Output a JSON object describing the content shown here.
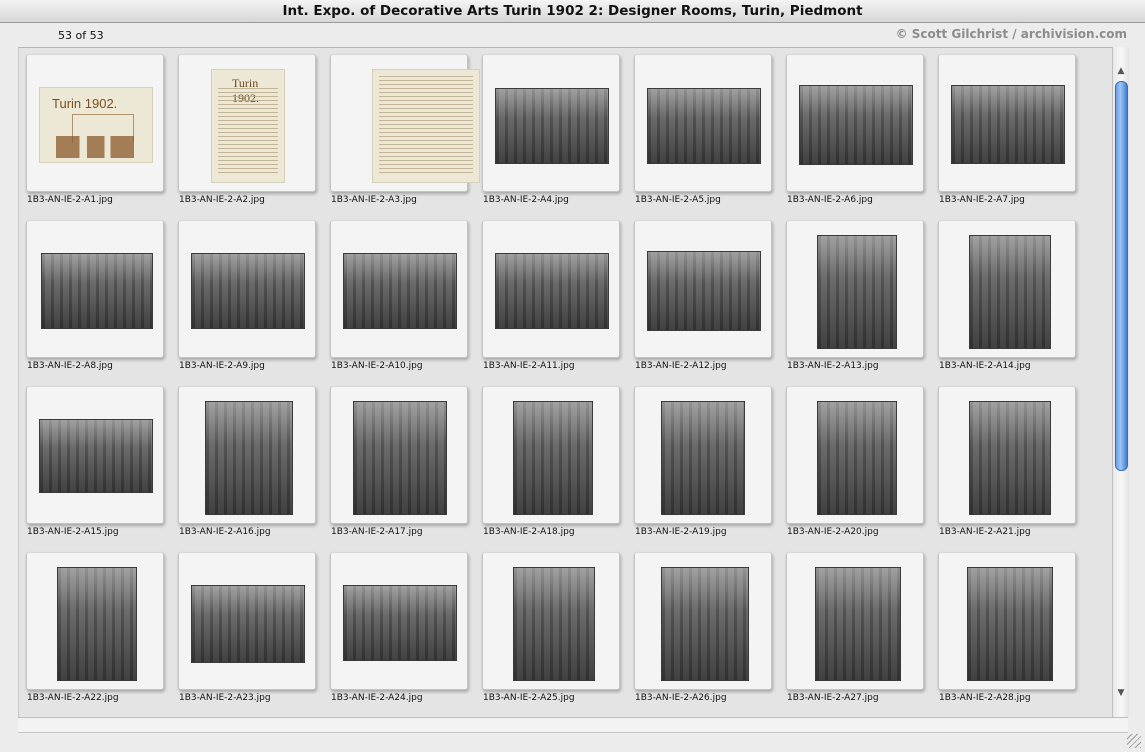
{
  "window": {
    "title": "Int. Expo. of Decorative Arts Turin 1902 2: Designer Rooms, Turin, Piedmont"
  },
  "header": {
    "count": "53 of 53",
    "credit": "© Scott Gilchrist / archivision.com"
  },
  "gallery": {
    "items": [
      {
        "filename": "1B3-AN-IE-2-A1.jpg",
        "image_text": "Turin 1902."
      },
      {
        "filename": "1B3-AN-IE-2-A2.jpg",
        "image_text": "Turin 1902."
      },
      {
        "filename": "1B3-AN-IE-2-A3.jpg"
      },
      {
        "filename": "1B3-AN-IE-2-A4.jpg"
      },
      {
        "filename": "1B3-AN-IE-2-A5.jpg"
      },
      {
        "filename": "1B3-AN-IE-2-A6.jpg"
      },
      {
        "filename": "1B3-AN-IE-2-A7.jpg"
      },
      {
        "filename": "1B3-AN-IE-2-A8.jpg"
      },
      {
        "filename": "1B3-AN-IE-2-A9.jpg"
      },
      {
        "filename": "1B3-AN-IE-2-A10.jpg"
      },
      {
        "filename": "1B3-AN-IE-2-A11.jpg"
      },
      {
        "filename": "1B3-AN-IE-2-A12.jpg"
      },
      {
        "filename": "1B3-AN-IE-2-A13.jpg"
      },
      {
        "filename": "1B3-AN-IE-2-A14.jpg"
      },
      {
        "filename": "1B3-AN-IE-2-A15.jpg"
      },
      {
        "filename": "1B3-AN-IE-2-A16.jpg"
      },
      {
        "filename": "1B3-AN-IE-2-A17.jpg"
      },
      {
        "filename": "1B3-AN-IE-2-A18.jpg"
      },
      {
        "filename": "1B3-AN-IE-2-A19.jpg"
      },
      {
        "filename": "1B3-AN-IE-2-A20.jpg"
      },
      {
        "filename": "1B3-AN-IE-2-A21.jpg"
      },
      {
        "filename": "1B3-AN-IE-2-A22.jpg"
      },
      {
        "filename": "1B3-AN-IE-2-A23.jpg"
      },
      {
        "filename": "1B3-AN-IE-2-A24.jpg"
      },
      {
        "filename": "1B3-AN-IE-2-A25.jpg"
      },
      {
        "filename": "1B3-AN-IE-2-A26.jpg"
      },
      {
        "filename": "1B3-AN-IE-2-A27.jpg"
      },
      {
        "filename": "1B3-AN-IE-2-A28.jpg"
      }
    ]
  },
  "scrollbar": {
    "up_arrow_icon": "arrow-up-icon",
    "down_arrow_icon": "arrow-down-icon"
  },
  "colors": {
    "window_bg": "#ececec",
    "pane_bg": "#e4e4e4",
    "scroll_thumb": "#6a9fe6",
    "credit_text": "#8c8c8c"
  }
}
